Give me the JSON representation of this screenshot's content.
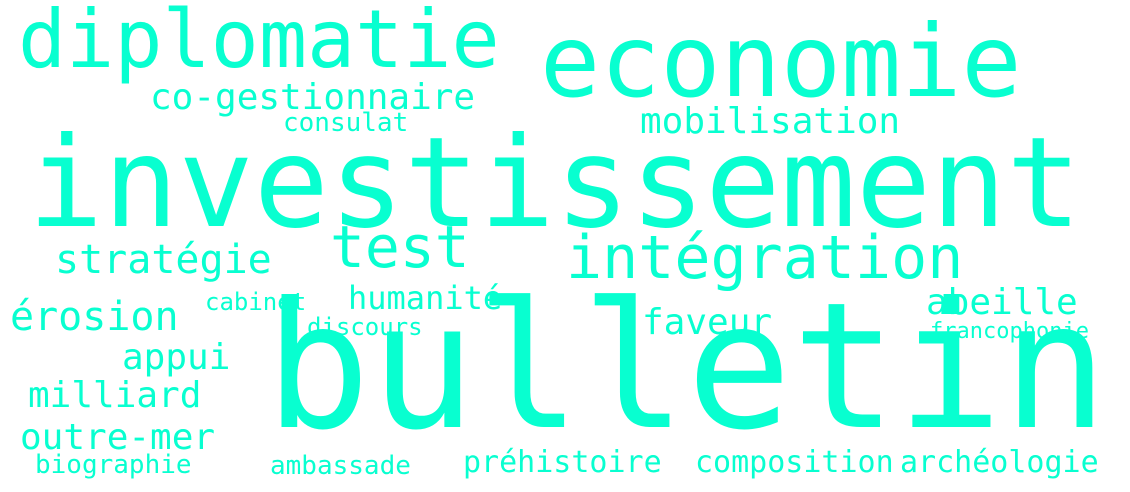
{
  "word_cloud": {
    "color": "#08ffd0",
    "background": "#ffffff",
    "words": [
      "diplomatie",
      "economie",
      "co-gestionnaire",
      "consulat",
      "mobilisation",
      "investissement",
      "test",
      "intégration",
      "stratégie",
      "humanité",
      "cabinet",
      "abeille",
      "érosion",
      "faveur",
      "discours",
      "francophonie",
      "bulletin",
      "appui",
      "milliard",
      "outre-mer",
      "biographie",
      "ambassade",
      "préhistoire",
      "composition",
      "archéologie"
    ]
  }
}
